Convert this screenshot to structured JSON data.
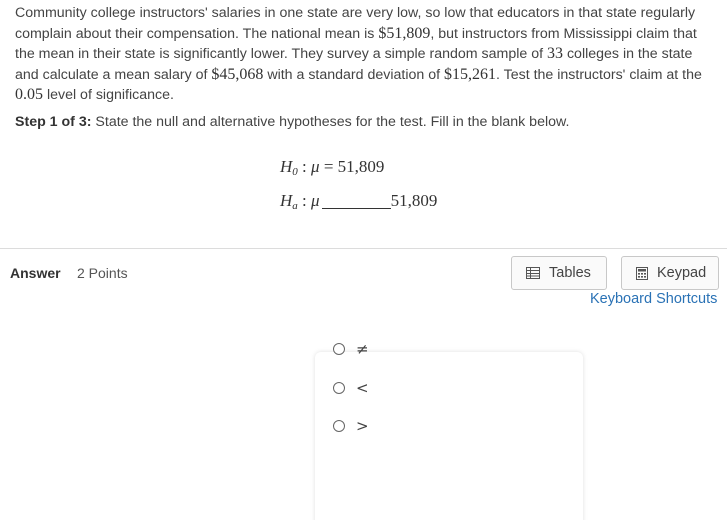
{
  "problem": {
    "t1": "Community college instructors' salaries in one state are very low, so low that educators in that state regularly complain about their compensation. The national mean is ",
    "mu_national": "$51,809",
    "t2": ", but instructors from Mississippi claim that the mean in their state is significantly lower. They survey a simple random sample of ",
    "n": "33",
    "t3": " colleges in the state and calculate a mean salary of ",
    "xbar": "$45,068",
    "t4": " with a standard deviation of ",
    "s": "$15,261",
    "t5": ". Test the instructors' claim at the ",
    "alpha": "0.05",
    "t6": " level of significance."
  },
  "step": {
    "label": "Step 1 of 3:",
    "text": " State the null and alternative hypotheses for the test. Fill in the blank below."
  },
  "hypotheses": {
    "h0_H": "H",
    "h0_sub": "0",
    "h0_colon": " :",
    "h0_mu": "μ",
    "h0_rest": " = 51,809",
    "ha_H": "H",
    "ha_sub": "a",
    "ha_colon": " :",
    "ha_mu": "μ",
    "ha_value": "51,809"
  },
  "answer": {
    "label": "Answer",
    "points": "2 Points"
  },
  "tools": {
    "tables_label": "Tables",
    "keypad_label": "Keypad",
    "shortcuts_label": "Keyboard Shortcuts"
  },
  "options": [
    "≠",
    "<",
    ">"
  ],
  "colors": {
    "link": "#2a72b5",
    "border": "#c8c8c8",
    "divider": "#dcdcdc"
  }
}
